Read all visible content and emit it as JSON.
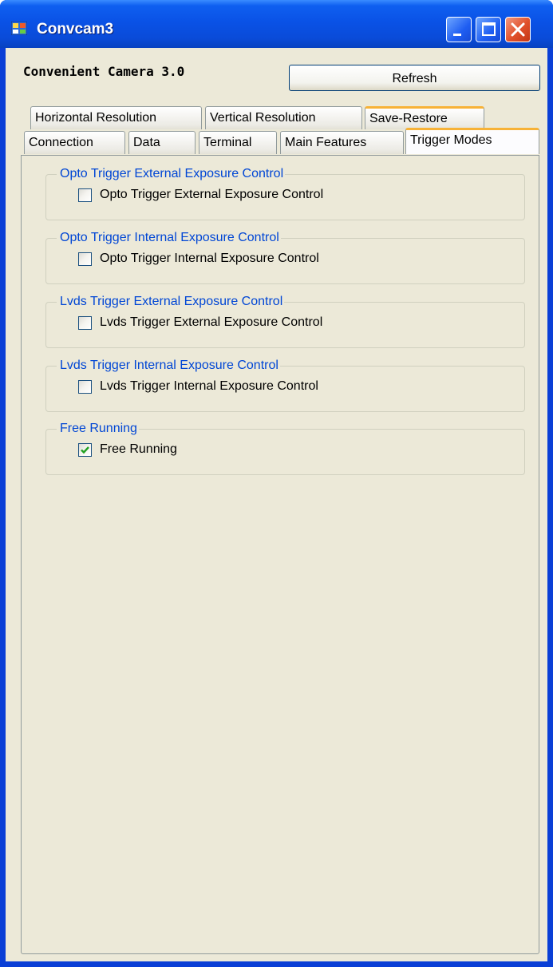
{
  "window": {
    "title": "Convcam3"
  },
  "header": {
    "app_name": "Convenient Camera 3.0",
    "refresh_label": "Refresh"
  },
  "tabs_row1": [
    {
      "label": "Horizontal Resolution"
    },
    {
      "label": "Vertical Resolution"
    },
    {
      "label": "Save-Restore"
    }
  ],
  "tabs_row2": [
    {
      "label": "Connection"
    },
    {
      "label": "Data"
    },
    {
      "label": "Terminal"
    },
    {
      "label": "Main Features"
    },
    {
      "label": "Trigger Modes",
      "selected": true
    }
  ],
  "groups": [
    {
      "legend": "Opto Trigger External Exposure Control",
      "checkbox_label": "Opto Trigger External Exposure Control",
      "checked": false
    },
    {
      "legend": "Opto Trigger Internal Exposure Control",
      "checkbox_label": "Opto Trigger Internal Exposure Control",
      "checked": false
    },
    {
      "legend": "Lvds Trigger External Exposure Control",
      "checkbox_label": "Lvds Trigger External Exposure Control",
      "checked": false
    },
    {
      "legend": "Lvds Trigger Internal Exposure Control",
      "checkbox_label": "Lvds Trigger Internal Exposure Control",
      "checked": false
    },
    {
      "legend": "Free Running",
      "checkbox_label": "Free Running",
      "checked": true
    }
  ],
  "colors": {
    "titlebar": "#0a52e6",
    "group_legend": "#0046d5",
    "tab_highlight": "#f7b237",
    "checkmark": "#21a121",
    "client_bg": "#ece9d8"
  },
  "icons": {
    "app": "app-window-icon",
    "minimize": "minimize-icon",
    "maximize": "maximize-icon",
    "close": "close-icon",
    "check": "checkmark-icon"
  }
}
